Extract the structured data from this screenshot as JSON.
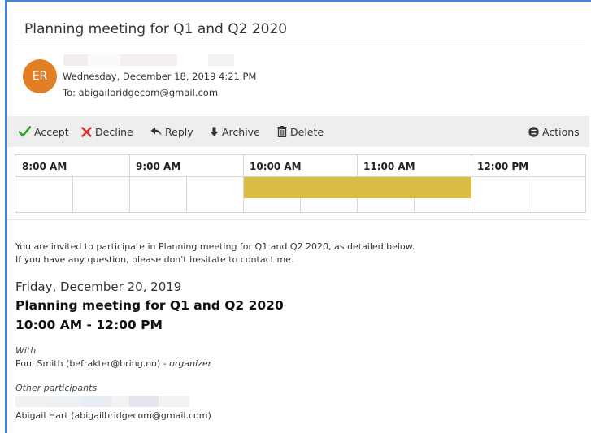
{
  "email": {
    "subject": "Planning meeting for Q1 and Q2 2020",
    "avatar_initials": "ER",
    "sent_date": "Wednesday, December 18, 2019 4:21 PM",
    "to_line": "To: abigailbridgecom@gmail.com"
  },
  "toolbar": {
    "accept_label": "Accept",
    "decline_label": "Decline",
    "reply_label": "Reply",
    "archive_label": "Archive",
    "delete_label": "Delete",
    "actions_label": "Actions"
  },
  "calendar": {
    "hours": [
      "8:00 AM",
      "9:00 AM",
      "10:00 AM",
      "11:00 AM",
      "12:00 PM"
    ],
    "event_color": "#d9bd47"
  },
  "body": {
    "intro_line1": "You are invited to participate in Planning meeting for Q1 and Q2 2020, as detailed below.",
    "intro_line2": "If you have any question, please don't hesitate to contact me.",
    "date_heading": "Friday, December 20, 2019",
    "meeting_title": "Planning meeting for Q1 and Q2 2020",
    "meeting_time": "10:00 AM - 12:00 PM",
    "with_label": "With",
    "organizer_name": "Poul Smith (befrakter@bring.no)",
    "organizer_suffix": " - organizer",
    "other_participants_label": "Other participants",
    "participant": "Abigail Hart (abigailbridgecom@gmail.com)"
  },
  "colors": {
    "accent_blue": "#3c87d6",
    "avatar_orange": "#e07f23",
    "accept_green": "#2e9e2e",
    "decline_red": "#d9342b"
  }
}
